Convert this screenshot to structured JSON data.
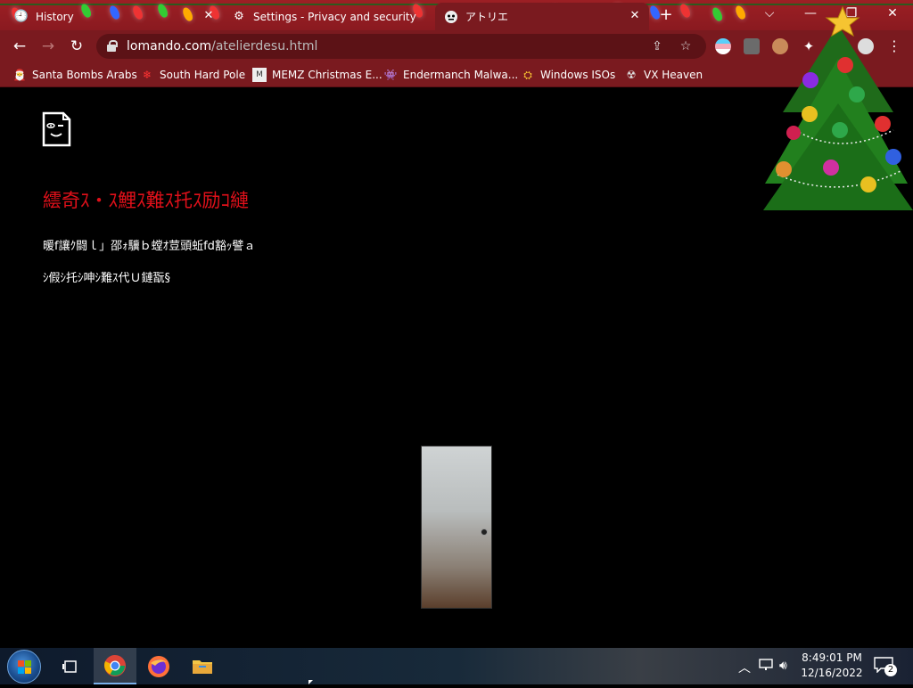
{
  "browser": {
    "tabs": [
      {
        "label": "History",
        "icon": "history-icon",
        "active": false
      },
      {
        "label": "Settings - Privacy and security",
        "icon": "gear-icon",
        "active": false
      },
      {
        "label": "アトリエ",
        "icon": "site-favicon",
        "active": true
      }
    ],
    "new_tab_label": "+",
    "window_controls": {
      "tab_search": "⌵",
      "minimize": "—",
      "maximize": "❐",
      "close": "✕"
    }
  },
  "toolbar": {
    "url_host": "lomando.com",
    "url_path": "/atelierdesu.html"
  },
  "bookmarks": [
    {
      "label": "Santa Bombs Arabs",
      "icon": "santa-icon"
    },
    {
      "label": "South Hard Pole",
      "icon": "snowflake-icon"
    },
    {
      "label": "MEMZ Christmas E...",
      "icon": "memz-icon"
    },
    {
      "label": "Endermanch Malwa...",
      "icon": "enderman-icon"
    },
    {
      "label": "Windows ISOs",
      "icon": "windows-icon"
    },
    {
      "label": "VX Heaven",
      "icon": "vx-icon"
    }
  ],
  "page": {
    "title": "繧奇ｽ・ｽ鯉ｽ難ｽ托ｽ励ｺ縺",
    "line1": "暖f讓ｸ闘ｌ」邵ｫ驥ｂ螳ｵ荳頭蚯fd豁ｯ譬ａ",
    "line2": "ｼ假ｼ托ｼ呻ｼ難ｽ代Ｕ鏈翫§"
  },
  "taskbar": {
    "time": "8:49:01 PM",
    "date": "12/16/2022",
    "notification_count": "2"
  },
  "colors": {
    "title_red": "#e0101a",
    "chrome_red": "#7a1a1f",
    "tab_red": "#9c1f24"
  }
}
